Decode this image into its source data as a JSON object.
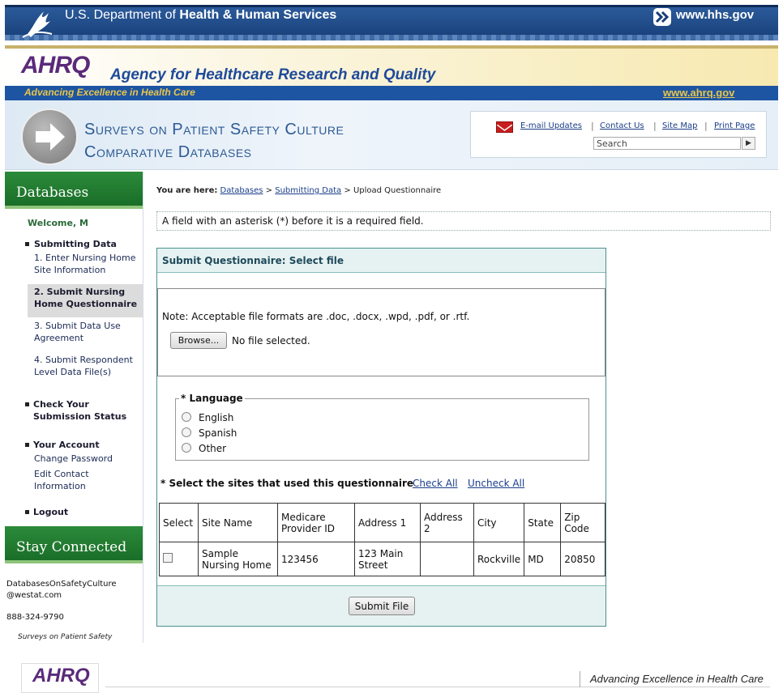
{
  "hhs": {
    "title_prefix": "U.S. Department of ",
    "title_bold": "Health & Human Services",
    "url": "www.hhs.gov"
  },
  "ahrq": {
    "logo": "AHRQ",
    "name": "Agency for Healthcare Research and Quality",
    "tagline": "Advancing Excellence in Health Care",
    "url": "www.ahrq.gov"
  },
  "survey_header": {
    "line1": "Surveys on Patient Safety Culture",
    "line2": "Comparative Databases"
  },
  "utility": {
    "email": "E-mail Updates",
    "contact": "Contact Us",
    "sitemap": "Site Map",
    "print": "Print Page",
    "search_value": "Search"
  },
  "sidebar": {
    "heading": "Databases",
    "welcome": "Welcome, M",
    "submitting": "Submitting Data",
    "step1": "1. Enter Nursing Home Site Information",
    "step2": "2. Submit Nursing Home Questionnaire",
    "step3": "3. Submit Data Use Agreement",
    "step4": "4. Submit Respondent Level Data File(s)",
    "check_status": "Check Your Submission Status",
    "your_account": "Your Account",
    "change_password": "Change Password",
    "edit_contact": "Edit Contact Information",
    "logout": "Logout",
    "stay_connected": "Stay Connected",
    "email_1": "DatabasesOnSafetyCulture",
    "email_2": "@westat.com",
    "phone": "888-324-9790",
    "survey_link": "Surveys on Patient Safety Culture"
  },
  "breadcrumb": {
    "label": "You are here:",
    "databases": "Databases",
    "sep": ">",
    "submitting": "Submitting Data",
    "current": "Upload Questionnaire"
  },
  "required_note": "A field with an asterisk (*) before it is a required field.",
  "panel": {
    "title": "Submit Questionnaire: Select file",
    "file_note": "Note: Acceptable file formats are .doc, .docx, .wpd, .pdf, or .rtf.",
    "browse": "Browse...",
    "no_file": "No file selected.",
    "language_legend": "* Language",
    "languages": [
      "English",
      "Spanish",
      "Other"
    ],
    "sites_label": "* Select the sites that used this questionnaire",
    "check_all": "Check All",
    "uncheck_all": "Uncheck All",
    "submit": "Submit File"
  },
  "table": {
    "headers": [
      "Select",
      "Site Name",
      "Medicare Provider ID",
      "Address 1",
      "Address 2",
      "City",
      "State",
      "Zip Code"
    ],
    "rows": [
      {
        "site": "Sample Nursing Home",
        "provider_id": "123456",
        "address1": "123 Main Street",
        "address2": "",
        "city": "Rockville",
        "state": "MD",
        "zip": "20850"
      }
    ]
  },
  "footer": {
    "logo": "AHRQ",
    "tagline": "Advancing Excellence in Health Care"
  },
  "colors": {
    "hhs_blue": "#1c4a8a",
    "ahrq_purple": "#5a2a7a",
    "sidebar_green": "#1a6e28",
    "panel_teal": "#4d8f8f",
    "link_blue": "#1a3d8a"
  }
}
